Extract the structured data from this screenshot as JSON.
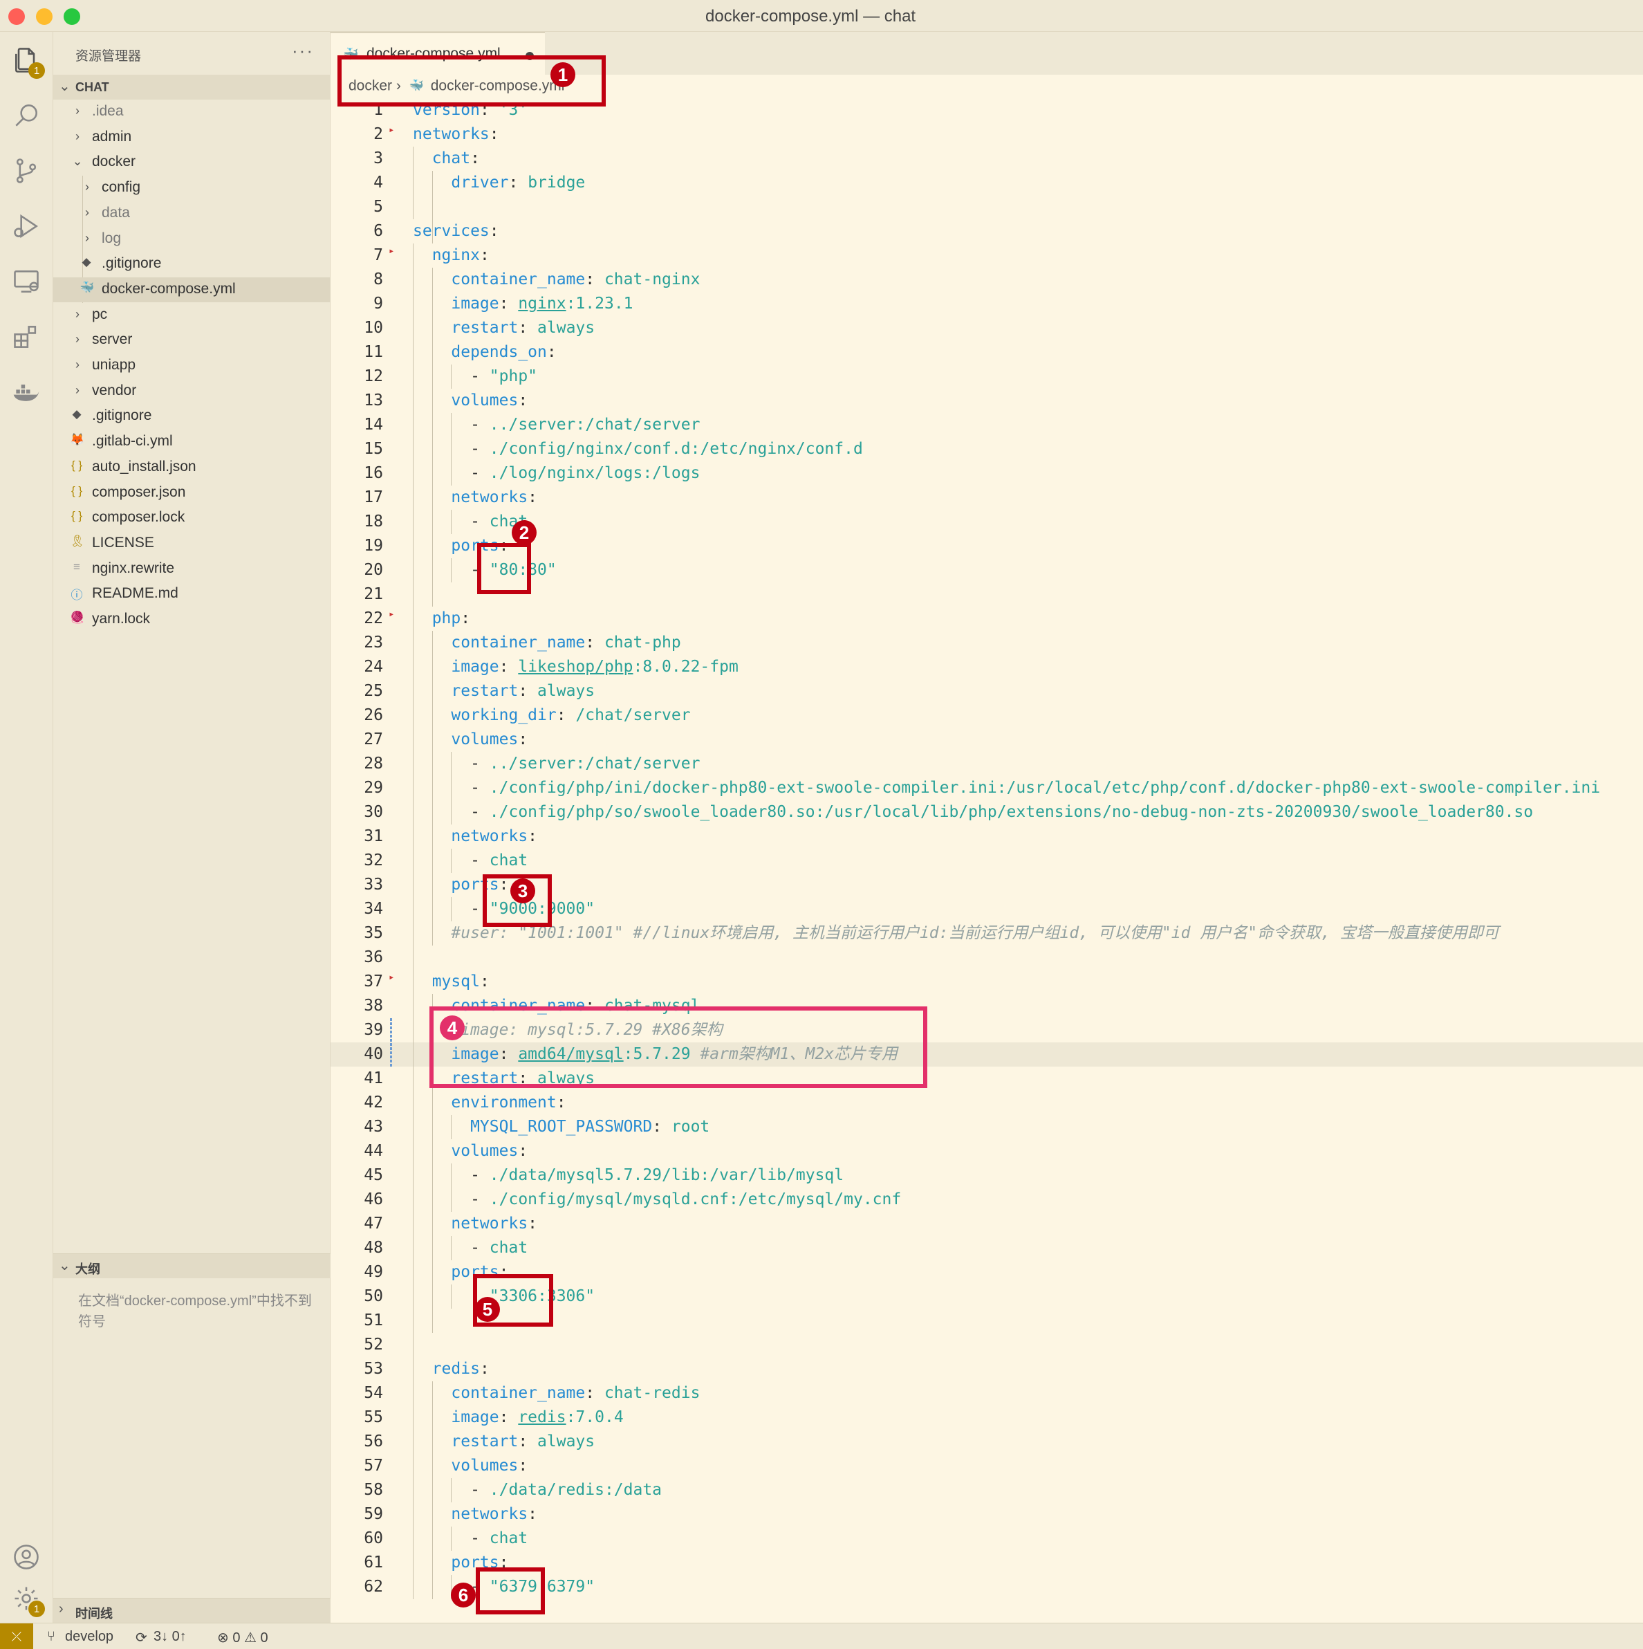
{
  "window": {
    "title": "docker-compose.yml — chat"
  },
  "activity_bar": {
    "items": [
      {
        "name": "explorer-icon",
        "badge": "1"
      },
      {
        "name": "search-icon"
      },
      {
        "name": "source-control-icon"
      },
      {
        "name": "run-debug-icon"
      },
      {
        "name": "remote-explorer-icon"
      },
      {
        "name": "extensions-icon"
      },
      {
        "name": "docker-icon"
      }
    ],
    "bottom": [
      {
        "name": "account-icon"
      },
      {
        "name": "settings-gear-icon",
        "badge": "1"
      }
    ]
  },
  "sidebar": {
    "title": "资源管理器",
    "more": "···",
    "workspace": "CHAT",
    "tree": [
      {
        "label": ".idea",
        "depth": 0,
        "kind": "folder",
        "open": false,
        "dim": true
      },
      {
        "label": "admin",
        "depth": 0,
        "kind": "folder",
        "open": false
      },
      {
        "label": "docker",
        "depth": 0,
        "kind": "folder",
        "open": true
      },
      {
        "label": "config",
        "depth": 1,
        "kind": "folder",
        "open": false
      },
      {
        "label": "data",
        "depth": 1,
        "kind": "folder",
        "open": false,
        "dim": true
      },
      {
        "label": "log",
        "depth": 1,
        "kind": "folder",
        "open": false,
        "dim": true
      },
      {
        "label": ".gitignore",
        "depth": 1,
        "kind": "git"
      },
      {
        "label": "docker-compose.yml",
        "depth": 1,
        "kind": "docker",
        "selected": true
      },
      {
        "label": "pc",
        "depth": 0,
        "kind": "folder",
        "open": false
      },
      {
        "label": "server",
        "depth": 0,
        "kind": "folder",
        "open": false
      },
      {
        "label": "uniapp",
        "depth": 0,
        "kind": "folder",
        "open": false
      },
      {
        "label": "vendor",
        "depth": 0,
        "kind": "folder",
        "open": false
      },
      {
        "label": ".gitignore",
        "depth": 0,
        "kind": "git"
      },
      {
        "label": ".gitlab-ci.yml",
        "depth": 0,
        "kind": "gitlab"
      },
      {
        "label": "auto_install.json",
        "depth": 0,
        "kind": "json"
      },
      {
        "label": "composer.json",
        "depth": 0,
        "kind": "json"
      },
      {
        "label": "composer.lock",
        "depth": 0,
        "kind": "json"
      },
      {
        "label": "LICENSE",
        "depth": 0,
        "kind": "license"
      },
      {
        "label": "nginx.rewrite",
        "depth": 0,
        "kind": "text"
      },
      {
        "label": "README.md",
        "depth": 0,
        "kind": "info"
      },
      {
        "label": "yarn.lock",
        "depth": 0,
        "kind": "yarn"
      }
    ],
    "outline_title": "大纲",
    "outline_message": "在文档“docker-compose.yml”中找不到符号",
    "timeline_title": "时间线"
  },
  "editor": {
    "tab_label": "docker-compose.yml",
    "breadcrumb": [
      "docker",
      "docker-compose.yml"
    ],
    "current_line": 40,
    "lines": [
      [
        [
          "k",
          "version"
        ],
        [
          "p",
          ": "
        ],
        [
          "s",
          "'3'"
        ]
      ],
      [
        [
          "k",
          "networks"
        ],
        [
          "p",
          ":"
        ]
      ],
      [
        [
          "k",
          "  chat"
        ],
        [
          "p",
          ":"
        ]
      ],
      [
        [
          "k",
          "    driver"
        ],
        [
          "p",
          ": "
        ],
        [
          "v",
          "bridge"
        ]
      ],
      [],
      [
        [
          "k",
          "services"
        ],
        [
          "p",
          ":"
        ]
      ],
      [
        [
          "k",
          "  nginx"
        ],
        [
          "p",
          ":"
        ]
      ],
      [
        [
          "k",
          "    container_name"
        ],
        [
          "p",
          ": "
        ],
        [
          "v",
          "chat-nginx"
        ]
      ],
      [
        [
          "k",
          "    image"
        ],
        [
          "p",
          ": "
        ],
        [
          "u",
          "nginx"
        ],
        [
          "v",
          ":1.23.1"
        ]
      ],
      [
        [
          "k",
          "    restart"
        ],
        [
          "p",
          ": "
        ],
        [
          "v",
          "always"
        ]
      ],
      [
        [
          "k",
          "    depends_on"
        ],
        [
          "p",
          ":"
        ]
      ],
      [
        [
          "p",
          "      - "
        ],
        [
          "s",
          "\"php\""
        ]
      ],
      [
        [
          "k",
          "    volumes"
        ],
        [
          "p",
          ":"
        ]
      ],
      [
        [
          "p",
          "      - "
        ],
        [
          "v",
          "../server:/chat/server"
        ]
      ],
      [
        [
          "p",
          "      - "
        ],
        [
          "v",
          "./config/nginx/conf.d:/etc/nginx/conf.d"
        ]
      ],
      [
        [
          "p",
          "      - "
        ],
        [
          "v",
          "./log/nginx/logs:/logs"
        ]
      ],
      [
        [
          "k",
          "    networks"
        ],
        [
          "p",
          ":"
        ]
      ],
      [
        [
          "p",
          "      - "
        ],
        [
          "v",
          "chat"
        ]
      ],
      [
        [
          "k",
          "    ports"
        ],
        [
          "p",
          ":"
        ]
      ],
      [
        [
          "p",
          "      - "
        ],
        [
          "s",
          "\"80:80\""
        ]
      ],
      [],
      [
        [
          "k",
          "  php"
        ],
        [
          "p",
          ":"
        ]
      ],
      [
        [
          "k",
          "    container_name"
        ],
        [
          "p",
          ": "
        ],
        [
          "v",
          "chat-php"
        ]
      ],
      [
        [
          "k",
          "    image"
        ],
        [
          "p",
          ": "
        ],
        [
          "u",
          "likeshop/php"
        ],
        [
          "v",
          ":8.0.22-fpm"
        ]
      ],
      [
        [
          "k",
          "    restart"
        ],
        [
          "p",
          ": "
        ],
        [
          "v",
          "always"
        ]
      ],
      [
        [
          "k",
          "    working_dir"
        ],
        [
          "p",
          ": "
        ],
        [
          "v",
          "/chat/server"
        ]
      ],
      [
        [
          "k",
          "    volumes"
        ],
        [
          "p",
          ":"
        ]
      ],
      [
        [
          "p",
          "      - "
        ],
        [
          "v",
          "../server:/chat/server"
        ]
      ],
      [
        [
          "p",
          "      - "
        ],
        [
          "v",
          "./config/php/ini/docker-php80-ext-swoole-compiler.ini:/usr/local/etc/php/conf.d/docker-php80-ext-swoole-compiler.ini"
        ]
      ],
      [
        [
          "p",
          "      - "
        ],
        [
          "v",
          "./config/php/so/swoole_loader80.so:/usr/local/lib/php/extensions/no-debug-non-zts-20200930/swoole_loader80.so"
        ]
      ],
      [
        [
          "k",
          "    networks"
        ],
        [
          "p",
          ":"
        ]
      ],
      [
        [
          "p",
          "      - "
        ],
        [
          "v",
          "chat"
        ]
      ],
      [
        [
          "k",
          "    ports"
        ],
        [
          "p",
          ":"
        ]
      ],
      [
        [
          "p",
          "      - "
        ],
        [
          "s",
          "\"9000:9000\""
        ]
      ],
      [
        [
          "c",
          "    #user: \"1001:1001\" #//linux环境启用, 主机当前运行用户id:当前运行用户组id, 可以使用\"id 用户名\"命令获取, 宝塔一般直接使用即可"
        ]
      ],
      [],
      [
        [
          "k",
          "  mysql"
        ],
        [
          "p",
          ":"
        ]
      ],
      [
        [
          "k",
          "    container_name"
        ],
        [
          "p",
          ": "
        ],
        [
          "v",
          "chat-mysql"
        ]
      ],
      [
        [
          "c",
          "    #image: mysql:5.7.29 #X86架构"
        ]
      ],
      [
        [
          "k",
          "    image"
        ],
        [
          "p",
          ": "
        ],
        [
          "u",
          "amd64/mysql"
        ],
        [
          "v",
          ":5.7.29 "
        ],
        [
          "c",
          "#arm架构M1、M2x芯片专用"
        ]
      ],
      [
        [
          "k",
          "    restart"
        ],
        [
          "p",
          ": "
        ],
        [
          "v",
          "always"
        ]
      ],
      [
        [
          "k",
          "    environment"
        ],
        [
          "p",
          ":"
        ]
      ],
      [
        [
          "k",
          "      MYSQL_ROOT_PASSWORD"
        ],
        [
          "p",
          ": "
        ],
        [
          "v",
          "root"
        ]
      ],
      [
        [
          "k",
          "    volumes"
        ],
        [
          "p",
          ":"
        ]
      ],
      [
        [
          "p",
          "      - "
        ],
        [
          "v",
          "./data/mysql5.7.29/lib:/var/lib/mysql"
        ]
      ],
      [
        [
          "p",
          "      - "
        ],
        [
          "v",
          "./config/mysql/mysqld.cnf:/etc/mysql/my.cnf"
        ]
      ],
      [
        [
          "k",
          "    networks"
        ],
        [
          "p",
          ":"
        ]
      ],
      [
        [
          "p",
          "      - "
        ],
        [
          "v",
          "chat"
        ]
      ],
      [
        [
          "k",
          "    ports"
        ],
        [
          "p",
          ":"
        ]
      ],
      [
        [
          "p",
          "      - "
        ],
        [
          "s",
          "\"3306:3306\""
        ]
      ],
      [],
      [],
      [
        [
          "k",
          "  redis"
        ],
        [
          "p",
          ":"
        ]
      ],
      [
        [
          "k",
          "    container_name"
        ],
        [
          "p",
          ": "
        ],
        [
          "v",
          "chat-redis"
        ]
      ],
      [
        [
          "k",
          "    image"
        ],
        [
          "p",
          ": "
        ],
        [
          "u",
          "redis"
        ],
        [
          "v",
          ":7.0.4"
        ]
      ],
      [
        [
          "k",
          "    restart"
        ],
        [
          "p",
          ": "
        ],
        [
          "v",
          "always"
        ]
      ],
      [
        [
          "k",
          "    volumes"
        ],
        [
          "p",
          ":"
        ]
      ],
      [
        [
          "p",
          "      - "
        ],
        [
          "v",
          "./data/redis:/data"
        ]
      ],
      [
        [
          "k",
          "    networks"
        ],
        [
          "p",
          ":"
        ]
      ],
      [
        [
          "p",
          "      - "
        ],
        [
          "v",
          "chat"
        ]
      ],
      [
        [
          "k",
          "    ports"
        ],
        [
          "p",
          ":"
        ]
      ],
      [
        [
          "p",
          "      - "
        ],
        [
          "s",
          "\"6379:6379\""
        ]
      ]
    ]
  },
  "annotations": [
    {
      "num": "1",
      "color": "#c00010"
    },
    {
      "num": "2",
      "color": "#c00010"
    },
    {
      "num": "3",
      "color": "#c00010"
    },
    {
      "num": "4",
      "color": "#e3306a"
    },
    {
      "num": "5",
      "color": "#c00010"
    },
    {
      "num": "6",
      "color": "#c00010"
    }
  ],
  "statusbar": {
    "remote_icon": "remote-icon",
    "branch": "develop",
    "sync": "3↓ 0↑",
    "problems": "⊗ 0 ⚠ 0"
  }
}
